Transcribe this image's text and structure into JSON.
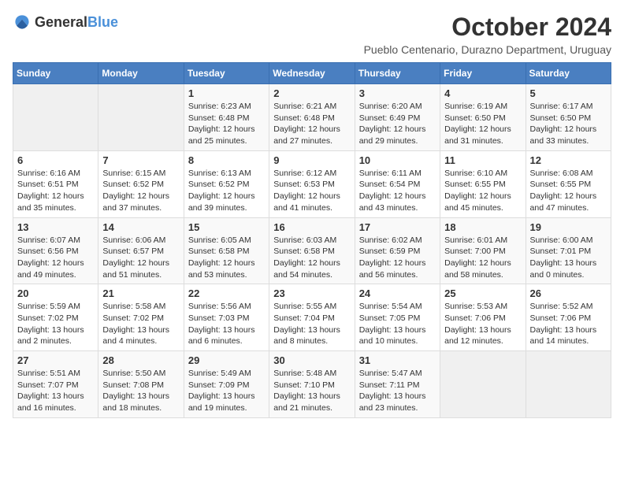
{
  "logo": {
    "general": "General",
    "blue": "Blue"
  },
  "title": "October 2024",
  "subtitle": "Pueblo Centenario, Durazno Department, Uruguay",
  "days_header": [
    "Sunday",
    "Monday",
    "Tuesday",
    "Wednesday",
    "Thursday",
    "Friday",
    "Saturday"
  ],
  "weeks": [
    [
      {
        "day": "",
        "info": ""
      },
      {
        "day": "",
        "info": ""
      },
      {
        "day": "1",
        "info": "Sunrise: 6:23 AM\nSunset: 6:48 PM\nDaylight: 12 hours and 25 minutes."
      },
      {
        "day": "2",
        "info": "Sunrise: 6:21 AM\nSunset: 6:48 PM\nDaylight: 12 hours and 27 minutes."
      },
      {
        "day": "3",
        "info": "Sunrise: 6:20 AM\nSunset: 6:49 PM\nDaylight: 12 hours and 29 minutes."
      },
      {
        "day": "4",
        "info": "Sunrise: 6:19 AM\nSunset: 6:50 PM\nDaylight: 12 hours and 31 minutes."
      },
      {
        "day": "5",
        "info": "Sunrise: 6:17 AM\nSunset: 6:50 PM\nDaylight: 12 hours and 33 minutes."
      }
    ],
    [
      {
        "day": "6",
        "info": "Sunrise: 6:16 AM\nSunset: 6:51 PM\nDaylight: 12 hours and 35 minutes."
      },
      {
        "day": "7",
        "info": "Sunrise: 6:15 AM\nSunset: 6:52 PM\nDaylight: 12 hours and 37 minutes."
      },
      {
        "day": "8",
        "info": "Sunrise: 6:13 AM\nSunset: 6:52 PM\nDaylight: 12 hours and 39 minutes."
      },
      {
        "day": "9",
        "info": "Sunrise: 6:12 AM\nSunset: 6:53 PM\nDaylight: 12 hours and 41 minutes."
      },
      {
        "day": "10",
        "info": "Sunrise: 6:11 AM\nSunset: 6:54 PM\nDaylight: 12 hours and 43 minutes."
      },
      {
        "day": "11",
        "info": "Sunrise: 6:10 AM\nSunset: 6:55 PM\nDaylight: 12 hours and 45 minutes."
      },
      {
        "day": "12",
        "info": "Sunrise: 6:08 AM\nSunset: 6:55 PM\nDaylight: 12 hours and 47 minutes."
      }
    ],
    [
      {
        "day": "13",
        "info": "Sunrise: 6:07 AM\nSunset: 6:56 PM\nDaylight: 12 hours and 49 minutes."
      },
      {
        "day": "14",
        "info": "Sunrise: 6:06 AM\nSunset: 6:57 PM\nDaylight: 12 hours and 51 minutes."
      },
      {
        "day": "15",
        "info": "Sunrise: 6:05 AM\nSunset: 6:58 PM\nDaylight: 12 hours and 53 minutes."
      },
      {
        "day": "16",
        "info": "Sunrise: 6:03 AM\nSunset: 6:58 PM\nDaylight: 12 hours and 54 minutes."
      },
      {
        "day": "17",
        "info": "Sunrise: 6:02 AM\nSunset: 6:59 PM\nDaylight: 12 hours and 56 minutes."
      },
      {
        "day": "18",
        "info": "Sunrise: 6:01 AM\nSunset: 7:00 PM\nDaylight: 12 hours and 58 minutes."
      },
      {
        "day": "19",
        "info": "Sunrise: 6:00 AM\nSunset: 7:01 PM\nDaylight: 13 hours and 0 minutes."
      }
    ],
    [
      {
        "day": "20",
        "info": "Sunrise: 5:59 AM\nSunset: 7:02 PM\nDaylight: 13 hours and 2 minutes."
      },
      {
        "day": "21",
        "info": "Sunrise: 5:58 AM\nSunset: 7:02 PM\nDaylight: 13 hours and 4 minutes."
      },
      {
        "day": "22",
        "info": "Sunrise: 5:56 AM\nSunset: 7:03 PM\nDaylight: 13 hours and 6 minutes."
      },
      {
        "day": "23",
        "info": "Sunrise: 5:55 AM\nSunset: 7:04 PM\nDaylight: 13 hours and 8 minutes."
      },
      {
        "day": "24",
        "info": "Sunrise: 5:54 AM\nSunset: 7:05 PM\nDaylight: 13 hours and 10 minutes."
      },
      {
        "day": "25",
        "info": "Sunrise: 5:53 AM\nSunset: 7:06 PM\nDaylight: 13 hours and 12 minutes."
      },
      {
        "day": "26",
        "info": "Sunrise: 5:52 AM\nSunset: 7:06 PM\nDaylight: 13 hours and 14 minutes."
      }
    ],
    [
      {
        "day": "27",
        "info": "Sunrise: 5:51 AM\nSunset: 7:07 PM\nDaylight: 13 hours and 16 minutes."
      },
      {
        "day": "28",
        "info": "Sunrise: 5:50 AM\nSunset: 7:08 PM\nDaylight: 13 hours and 18 minutes."
      },
      {
        "day": "29",
        "info": "Sunrise: 5:49 AM\nSunset: 7:09 PM\nDaylight: 13 hours and 19 minutes."
      },
      {
        "day": "30",
        "info": "Sunrise: 5:48 AM\nSunset: 7:10 PM\nDaylight: 13 hours and 21 minutes."
      },
      {
        "day": "31",
        "info": "Sunrise: 5:47 AM\nSunset: 7:11 PM\nDaylight: 13 hours and 23 minutes."
      },
      {
        "day": "",
        "info": ""
      },
      {
        "day": "",
        "info": ""
      }
    ]
  ]
}
